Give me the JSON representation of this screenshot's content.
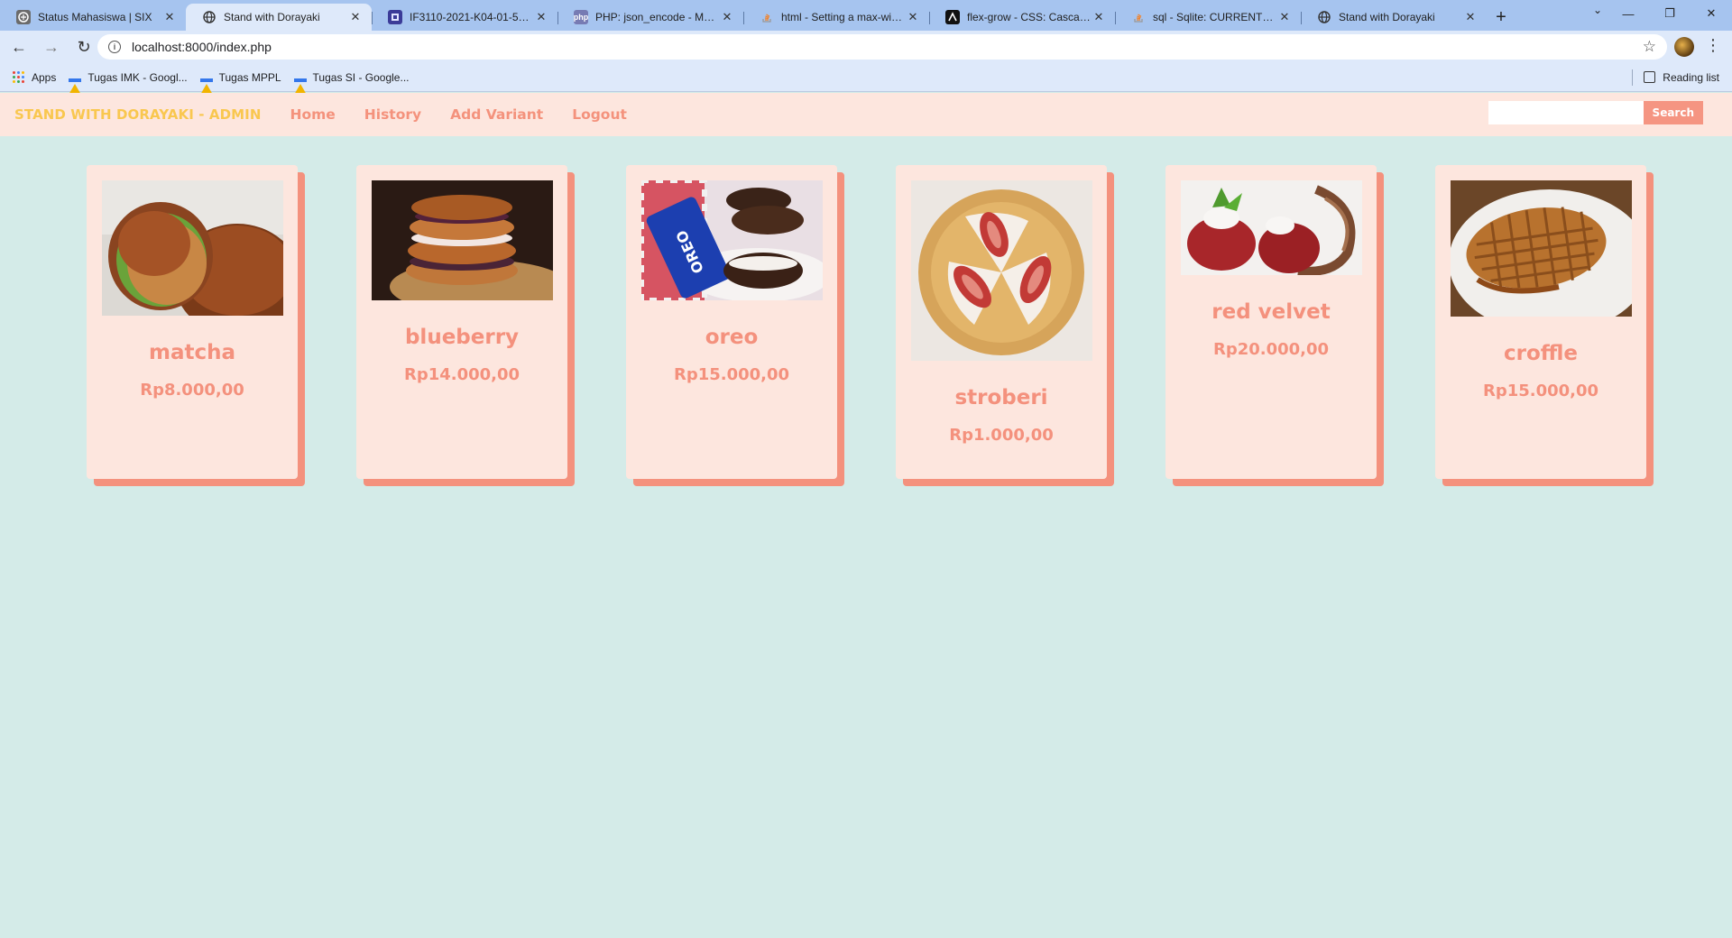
{
  "browser": {
    "tabs": [
      {
        "title": "Status Mahasiswa | SIX",
        "icon": "six-favicon-icon",
        "active": false
      },
      {
        "title": "Stand with Dorayaki",
        "icon": "globe-icon",
        "active": true
      },
      {
        "title": "IF3110-2021-K04-01-56 / T",
        "icon": "gitlab-favicon-icon",
        "active": false
      },
      {
        "title": "PHP: json_encode - Manual",
        "icon": "php-favicon-icon",
        "active": false
      },
      {
        "title": "html - Setting a max-width",
        "icon": "stackoverflow-favicon-icon",
        "active": false
      },
      {
        "title": "flex-grow - CSS: Cascading",
        "icon": "mdn-favicon-icon",
        "active": false
      },
      {
        "title": "sql - Sqlite: CURRENT_TIM",
        "icon": "stackoverflow-favicon-icon",
        "active": false
      },
      {
        "title": "Stand with Dorayaki",
        "icon": "globe-icon",
        "active": false
      }
    ],
    "url": "localhost:8000/index.php",
    "bookmarks": [
      {
        "label": "Apps",
        "icon": "apps-grid-icon"
      },
      {
        "label": "Tugas IMK - Googl...",
        "icon": "google-drive-icon"
      },
      {
        "label": "Tugas MPPL",
        "icon": "google-drive-icon"
      },
      {
        "label": "Tugas SI - Google...",
        "icon": "google-drive-icon"
      }
    ],
    "reading_list": "Reading list"
  },
  "nav": {
    "brand": "STAND WITH DORAYAKI - ADMIN",
    "links": [
      "Home",
      "History",
      "Add Variant",
      "Logout"
    ],
    "search_value": "",
    "search_button": "Search"
  },
  "variants": [
    {
      "name": "matcha",
      "price": "Rp8.000,00",
      "image": "matcha-dorayaki-photo"
    },
    {
      "name": "blueberry",
      "price": "Rp14.000,00",
      "image": "blueberry-dorayaki-photo"
    },
    {
      "name": "oreo",
      "price": "Rp15.000,00",
      "image": "oreo-dorayaki-photo"
    },
    {
      "name": "stroberi",
      "price": "Rp1.000,00",
      "image": "strawberry-dorayaki-photo"
    },
    {
      "name": "red velvet",
      "price": "Rp20.000,00",
      "image": "red-velvet-dorayaki-photo"
    },
    {
      "name": "croffle",
      "price": "Rp15.000,00",
      "image": "croffle-photo"
    }
  ],
  "colors": {
    "page_bg": "#d4ebe8",
    "nav_bg": "#fde6de",
    "brand": "#f9c74f",
    "accent": "#f4917d",
    "card_bg": "#fde6de"
  }
}
